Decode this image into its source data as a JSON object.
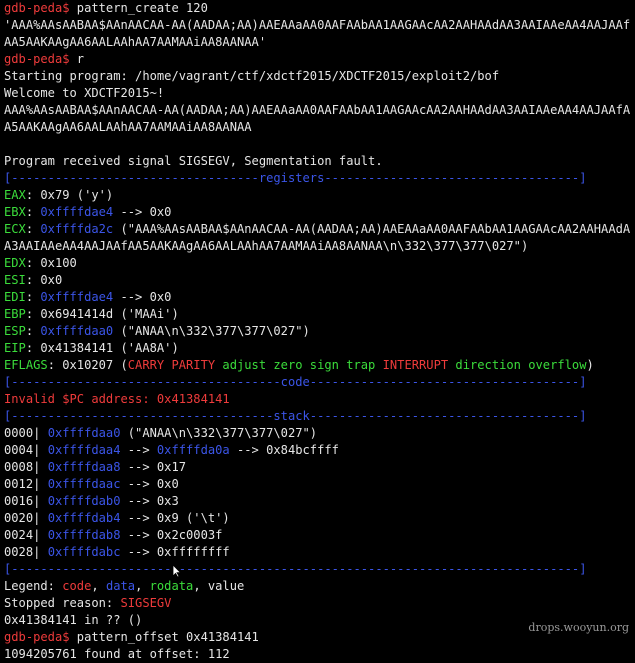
{
  "lines": {
    "l1p": "gdb-peda$",
    "l1c": " pattern_create 120",
    "l2": "'AAA%AAsAABAA$AAnAACAA-AA(AADAA;AA)AAEAAaAA0AAFAAbAA1AAGAAcAA2AAHAAdAA3AAIAAeAA4AAJAAfAA5AAKAAgAA6AALAAhAA7AAMAAiAA8AANAA'",
    "l3p": "gdb-peda$",
    "l3c": " r",
    "l4": "Starting program: /home/vagrant/ctf/xdctf2015/XDCTF2015/exploit2/bof",
    "l5": "Welcome to XDCTF2015~!",
    "l6": "AAA%AAsAABAA$AAnAACAA-AA(AADAA;AA)AAEAAaAA0AAFAAbAA1AAGAAcAA2AAHAAdAA3AAIAAeAA4AAJAAfAA5AAKAAgAA6AALAAhAA7AAMAAiAA8AANAA",
    "l7": "Program received signal SIGSEGV, Segmentation fault.",
    "sep_registers": "[----------------------------------registers-----------------------------------]",
    "eax_l": "EAX",
    "eax_v": ": 0x79 ('y')",
    "ebx_l": "EBX",
    "ebx_s": ": ",
    "ebx_a": "0xffffdae4",
    "ebx_v": " --> 0x0",
    "ecx_l": "ECX",
    "ecx_s": ": ",
    "ecx_a": "0xffffda2c",
    "ecx_v": " (\"AAA%AAsAABAA$AAnAACAA-AA(AADAA;AA)AAEAAaAA0AAFAAbAA1AAGAAcAA2AAHAAdAA3AAIAAeAA4AAJAAfAA5AAKAAgAA6AALAAhAA7AAMAAiAA8AANAA\\n\\332\\377\\377\\027\")",
    "edx_l": "EDX",
    "edx_v": ": 0x100",
    "esi_l": "ESI",
    "esi_v": ": 0x0",
    "edi_l": "EDI",
    "edi_s": ": ",
    "edi_a": "0xffffdae4",
    "edi_v": " --> 0x0",
    "ebp_l": "EBP",
    "ebp_v": ": 0x6941414d ('MAAi')",
    "esp_l": "ESP",
    "esp_s": ": ",
    "esp_a": "0xffffdaa0",
    "esp_v": " (\"ANAA\\n\\332\\377\\377\\027\")",
    "eip_l": "EIP",
    "eip_v": ": 0x41384141 ('AA8A')",
    "efl_l": "EFLAGS",
    "efl_v": ": 0x10207 (",
    "efl_carry": "CARRY PARITY",
    "efl_mid": " adjust zero sign trap ",
    "efl_int": "INTERRUPT",
    "efl_end": " direction overflow",
    "efl_close": ")",
    "sep_code": "[-------------------------------------code-------------------------------------]",
    "invalid_pc": "Invalid $PC address: 0x41384141",
    "sep_stack": "[------------------------------------stack-------------------------------------]",
    "s0_o": "0000| ",
    "s0_a": "0xffffdaa0",
    "s0_v": " (\"ANAA\\n\\332\\377\\377\\027\")",
    "s1_o": "0004| ",
    "s1_a": "0xffffdaa4",
    "s1_m": " --> ",
    "s1_a2": "0xffffda0a",
    "s1_v": " --> 0x84bcffff",
    "s2_o": "0008| ",
    "s2_a": "0xffffdaa8",
    "s2_v": " --> 0x17",
    "s3_o": "0012| ",
    "s3_a": "0xffffdaac",
    "s3_v": " --> 0x0",
    "s4_o": "0016| ",
    "s4_a": "0xffffdab0",
    "s4_v": " --> 0x3",
    "s5_o": "0020| ",
    "s5_a": "0xffffdab4",
    "s5_v": " --> 0x9 ('\\t')",
    "s6_o": "0024| ",
    "s6_a": "0xffffdab8",
    "s6_v": " --> 0x2c0003f",
    "s7_o": "0028| ",
    "s7_a": "0xffffdabc",
    "s7_v": " --> 0xffffffff",
    "sep_end": "[------------------------------------------------------------------------------]",
    "legend_l": "Legend: ",
    "legend_code": "code",
    "legend_c1": ", ",
    "legend_data": "data",
    "legend_c2": ", ",
    "legend_rodata": "rodata",
    "legend_c3": ", value",
    "stop_l": "Stopped reason: ",
    "stop_v": "SIGSEGV",
    "frame": "0x41384141 in ?? ()",
    "l_last_p": "gdb-peda$",
    "l_last_c": " pattern_offset 0x41384141",
    "result": "1094205761 found at offset: 112"
  },
  "watermark": "drops.wooyun.org",
  "colors": {
    "red": "#ee3b3b",
    "green": "#3bdc3b",
    "blue": "#3b55e8"
  },
  "icons": {
    "cursor": "mouse-cursor-icon"
  }
}
